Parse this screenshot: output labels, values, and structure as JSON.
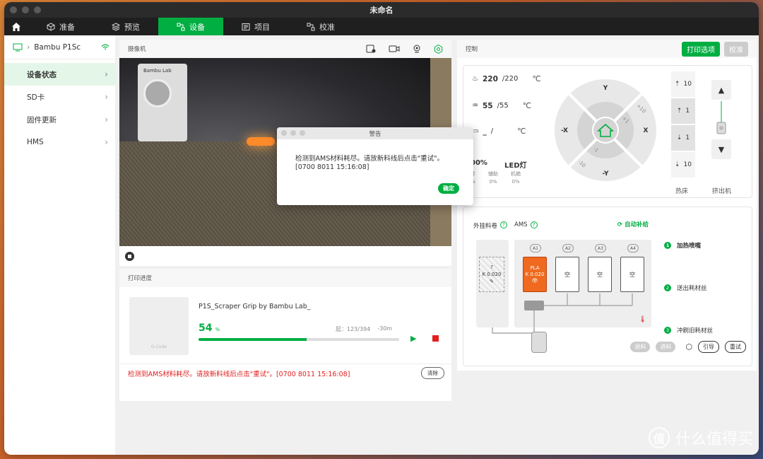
{
  "window": {
    "title": "未命名"
  },
  "tabs": [
    {
      "label": "准备"
    },
    {
      "label": "预览"
    },
    {
      "label": "设备"
    },
    {
      "label": "项目"
    },
    {
      "label": "校准"
    }
  ],
  "sidebar": {
    "printer": "Bambu P1Sc",
    "items": [
      {
        "label": "设备状态"
      },
      {
        "label": "SD卡"
      },
      {
        "label": "固件更新"
      },
      {
        "label": "HMS"
      }
    ]
  },
  "camera": {
    "title": "摄像机",
    "head_logo": "Bambu Lab"
  },
  "progress": {
    "title": "打印进度",
    "thumb_label": "G-Code",
    "job_name": "P1S_Scraper Grip by Bambu Lab_",
    "percent": "54",
    "percent_unit": "%",
    "percent_value": 54,
    "layer_label": "层：",
    "layers": "123/394",
    "remaining": "-30m",
    "error": "检测到AMS材料耗尽。请放新料线后点击\"重试\"。[0700 8011 15:16:08]",
    "clear": "清除"
  },
  "control": {
    "title": "控制",
    "print_options": "打印选项",
    "calibrate": "校准",
    "nozzle_temp": "220",
    "nozzle_target": "/220",
    "bed_temp": "55",
    "bed_target": "/55",
    "chamber_temp": "_",
    "chamber_target": "/",
    "unit": "℃",
    "speed_pct": "00%",
    "led": "LED灯",
    "fans": [
      {
        "label": "件",
        "value": "%"
      },
      {
        "label": "辅助",
        "value": "0%"
      },
      {
        "label": "机箱",
        "value": "0%"
      }
    ],
    "jog": {
      "y": "Y",
      "ny": "-Y",
      "x": "X",
      "nx": "-X",
      "p10": "+10",
      "p1": "+1",
      "n1": "-1",
      "n10": "-10"
    },
    "z_buttons": [
      "10",
      "1",
      "1",
      "10"
    ],
    "bed_label": "热床",
    "extruder_label": "挤出机"
  },
  "ams": {
    "external_label": "外挂料卷",
    "external_slot_q": "?",
    "external_slot_k": "K 0.020",
    "ams_label": "AMS",
    "auto_refill": "自动补给",
    "slots": [
      {
        "id": "A1",
        "name": "PLA",
        "k": "K 0.020",
        "color": "#ef6a1e"
      },
      {
        "id": "A2",
        "name": "空"
      },
      {
        "id": "A3",
        "name": "空"
      },
      {
        "id": "A4",
        "name": "空"
      }
    ],
    "steps": [
      {
        "num": "1",
        "label": "加热喷嘴"
      },
      {
        "num": "2",
        "label": "送出耗材丝"
      },
      {
        "num": "3",
        "label": "冲刷旧耗材丝"
      }
    ],
    "unload": "退料",
    "load": "进料",
    "guide": "引导",
    "retry": "重试"
  },
  "dialog": {
    "title": "警告",
    "message": "检测到AMS材料耗尽。请放新料线后点击\"重试\"。[0700 8011 15:16:08]",
    "ok": "确定"
  },
  "watermark": {
    "badge": "值",
    "text": "什么值得买"
  }
}
